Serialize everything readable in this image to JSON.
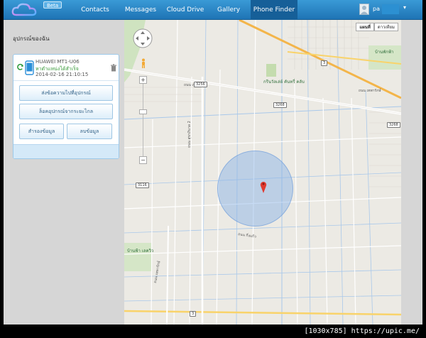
{
  "nav": {
    "beta": "Beta",
    "items": [
      {
        "label": "Contacts"
      },
      {
        "label": "Messages"
      },
      {
        "label": "Cloud Drive"
      },
      {
        "label": "Gallery"
      },
      {
        "label": "Phone Finder",
        "active": true
      }
    ],
    "username": "pa",
    "colors": {
      "bar_top": "#3a9ad6",
      "bar_bottom": "#1f74b5",
      "active_tab": "#165f98"
    }
  },
  "sidebar": {
    "title": "อุปกรณ์ของฉัน",
    "device": {
      "name": "HUAWEI MT1-U06",
      "status": "หาตำแหน่งได้สำเร็จ",
      "timestamp": "2014-02-16 21:10:15"
    },
    "buttons": {
      "send_message": "ส่งข้อความไปที่อุปกรณ์",
      "lock_device": "ล็อคอุปกรณ์จากระยะไกล",
      "backup": "สำรองข้อมูล",
      "erase": "ลบข้อมูล"
    }
  },
  "map": {
    "map_type": {
      "map": "แผนที่",
      "satellite": "ดาวเทียม"
    },
    "zoom_in": "+",
    "zoom_out": "−",
    "road_labels": [
      "ถนน เทพารักษ์",
      "ถนน เทพารักษ์",
      "ถนน สุขาภิบาล 2",
      "ถนน กิ่งแก้ว",
      "ถนน เทพารักษ์"
    ],
    "shields": [
      "3256",
      "3268",
      "3268",
      "3116",
      "3",
      "3"
    ],
    "places": [
      "กรีนวัลเล่ย์ คันทรี่ คลับ",
      "บ้านพักฟ้า",
      "บ้านฟ้า เลควิว"
    ]
  },
  "watermark": "[1030x785] https://upic.me/"
}
